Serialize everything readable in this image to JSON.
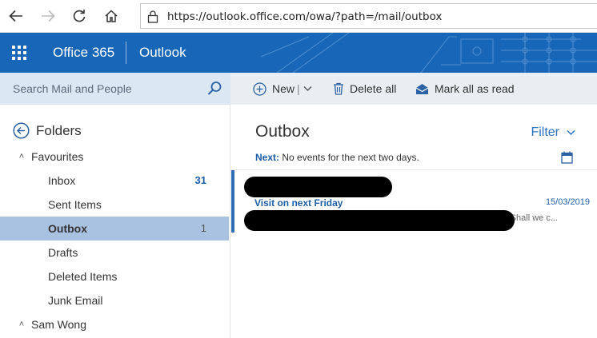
{
  "browser": {
    "url": "https://outlook.office.com/owa/?path=/mail/outbox"
  },
  "header": {
    "suite_name": "Office 365",
    "app_name": "Outlook",
    "brand_color": "#1766b8"
  },
  "search": {
    "placeholder": "Search Mail and People"
  },
  "toolbar": {
    "new_label": "New",
    "new_separator": "|",
    "delete_all_label": "Delete all",
    "mark_all_read_label": "Mark all as read"
  },
  "folders": {
    "heading": "Folders",
    "favourites_label": "Favourites",
    "items": [
      {
        "label": "Inbox",
        "count": "31"
      },
      {
        "label": "Sent Items",
        "count": ""
      },
      {
        "label": "Outbox",
        "count": "1"
      },
      {
        "label": "Drafts",
        "count": ""
      },
      {
        "label": "Deleted Items",
        "count": ""
      },
      {
        "label": "Junk Email",
        "count": ""
      }
    ],
    "account_label": "Sam Wong",
    "selected_color": "#a9c2e1"
  },
  "message_list": {
    "title": "Outbox",
    "filter_label": "Filter",
    "next_label": "Next:",
    "next_text": "No events for the next two days.",
    "messages": [
      {
        "subject": "Visit on next Friday",
        "date": "15/03/2019",
        "preview_visible": "Shall we c..."
      }
    ]
  }
}
